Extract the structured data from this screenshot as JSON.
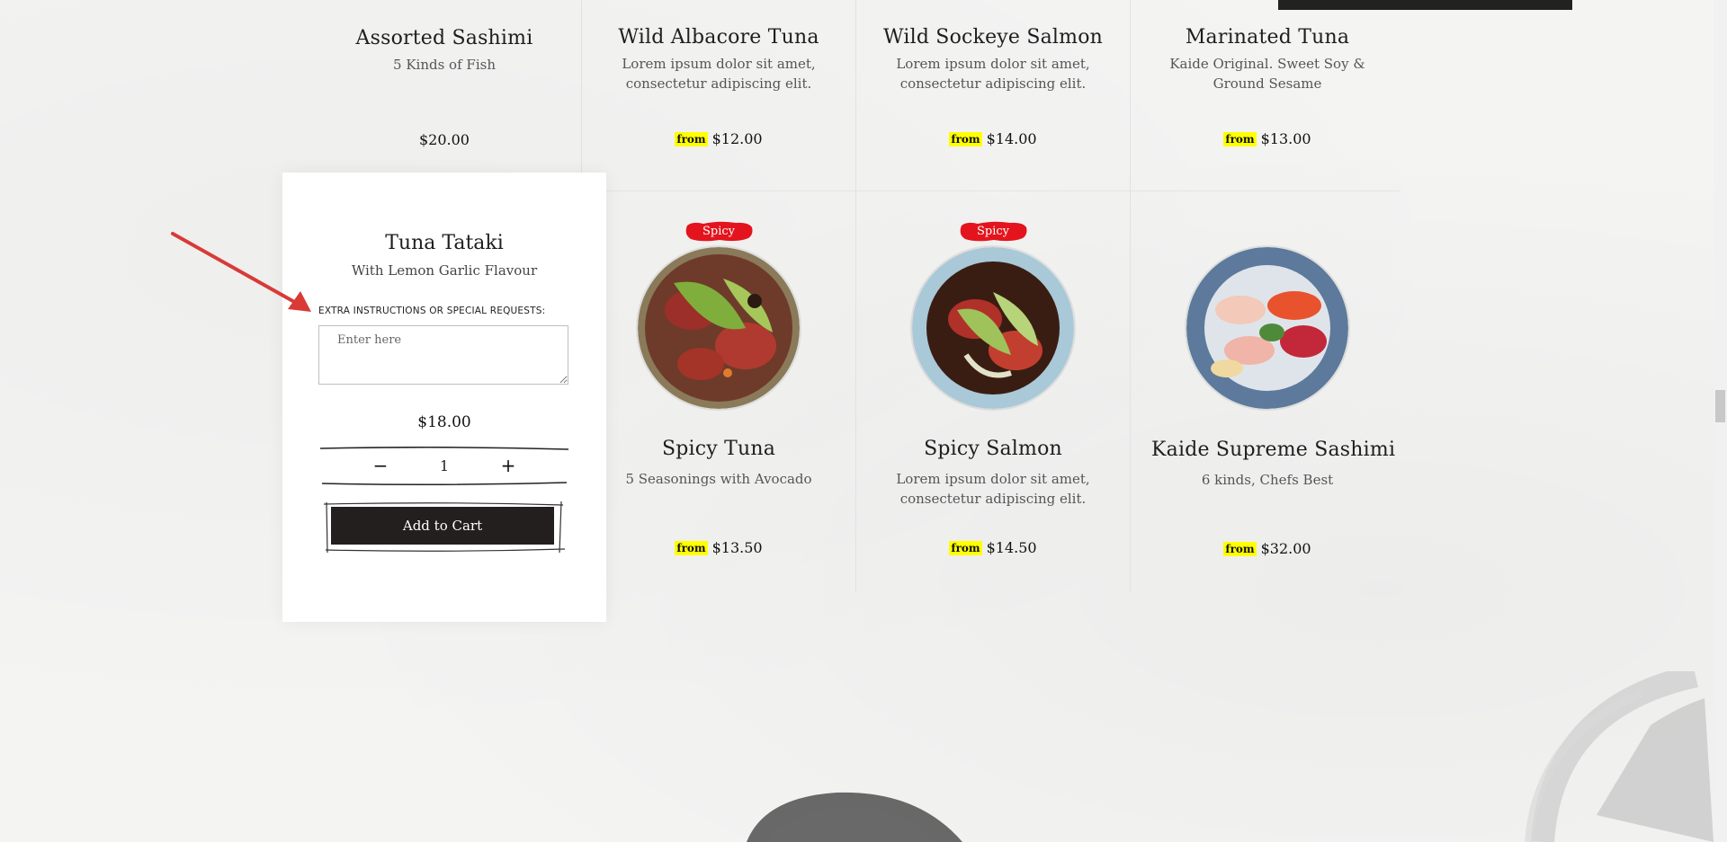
{
  "row1": [
    {
      "name": "Assorted Sashimi",
      "desc": "5 Kinds of Fish",
      "price": "$20.00",
      "from": ""
    },
    {
      "name": "Wild Albacore Tuna",
      "desc": "Lorem ipsum dolor sit amet, consectetur adipiscing elit.",
      "price": "$12.00",
      "from": "from"
    },
    {
      "name": "Wild Sockeye Salmon",
      "desc": "Lorem ipsum dolor sit amet, consectetur adipiscing elit.",
      "price": "$14.00",
      "from": "from"
    },
    {
      "name": "Marinated Tuna",
      "desc": "Kaide Original. Sweet Soy & Ground Sesame",
      "price": "$13.00",
      "from": "from"
    }
  ],
  "row2": [
    {
      "name": "Spicy Tuna",
      "desc": "5 Seasonings with Avocado",
      "price": "$13.50",
      "from": "from",
      "badge": "Spicy"
    },
    {
      "name": "Spicy Salmon",
      "desc": "Lorem ipsum dolor sit amet, consectetur adipiscing elit.",
      "price": "$14.50",
      "from": "from",
      "badge": "Spicy"
    },
    {
      "name": "Kaide Supreme Sashimi",
      "desc": "6 kinds, Chefs Best",
      "price": "$32.00",
      "from": "from",
      "badge": ""
    }
  ],
  "popup": {
    "name": "Tuna Tataki",
    "subtitle": "With Lemon Garlic Flavour",
    "instructions_label": "EXTRA INSTRUCTIONS OR SPECIAL REQUESTS:",
    "instructions_placeholder": "Enter here",
    "price": "$18.00",
    "minus": "−",
    "quantity": "1",
    "plus": "+",
    "add_to_cart": "Add to Cart"
  },
  "colors": {
    "badge": "#e3141d",
    "from_highlight": "#ffff00",
    "button": "#231f1f",
    "arrow": "#d93a36"
  }
}
